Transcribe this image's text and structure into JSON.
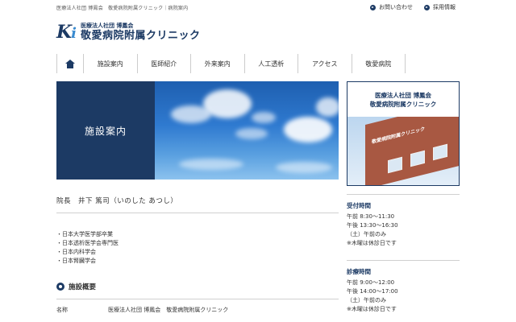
{
  "header": {
    "breadcrumb": "医療法人社団 博鳳会　敬愛病院附属クリニック｜病院案内",
    "links": [
      {
        "label": "お問い合わせ"
      },
      {
        "label": "採用情報"
      }
    ],
    "logo": {
      "mark": "K",
      "mark_i": "i",
      "corp": "医療法人社団 博鳳会",
      "name": "敬愛病院附属クリニック"
    }
  },
  "nav": {
    "items": [
      "施設案内",
      "医師紹介",
      "外来案内",
      "人工透析",
      "アクセス",
      "敬愛病院"
    ]
  },
  "hero": {
    "label": "施設案内"
  },
  "sidebar": {
    "card_line1": "医療法人社団 博鳳会",
    "card_line2": "敬愛病院附属クリニック",
    "photo_sign": "敬愛病院附属クリニック",
    "reception": {
      "title": "受付時間",
      "lines": [
        "午前 8:30～11:30",
        "午後 13:30～16:30",
        "（土）午前のみ",
        "※木曜は休診日です"
      ]
    },
    "consult": {
      "title": "診療時間",
      "lines": [
        "午前 9:00～12:00",
        "午後 14:00～17:00",
        "（土）午前のみ",
        "※木曜は休診日です"
      ]
    }
  },
  "main": {
    "director": "院長　井下 篤司（いのした あつし）",
    "qualifications": [
      "・日本大学医学部卒業",
      "・日本透析医学会専門医",
      "・日本内科学会",
      "・日本腎臓学会"
    ],
    "section_title": "施設概要",
    "info": {
      "key": "名称",
      "value": "医療法人社団 博鳳会　敬愛病院附属クリニック"
    }
  },
  "colors": {
    "brand": "#1c3a64",
    "accent": "#3a8bd0"
  }
}
